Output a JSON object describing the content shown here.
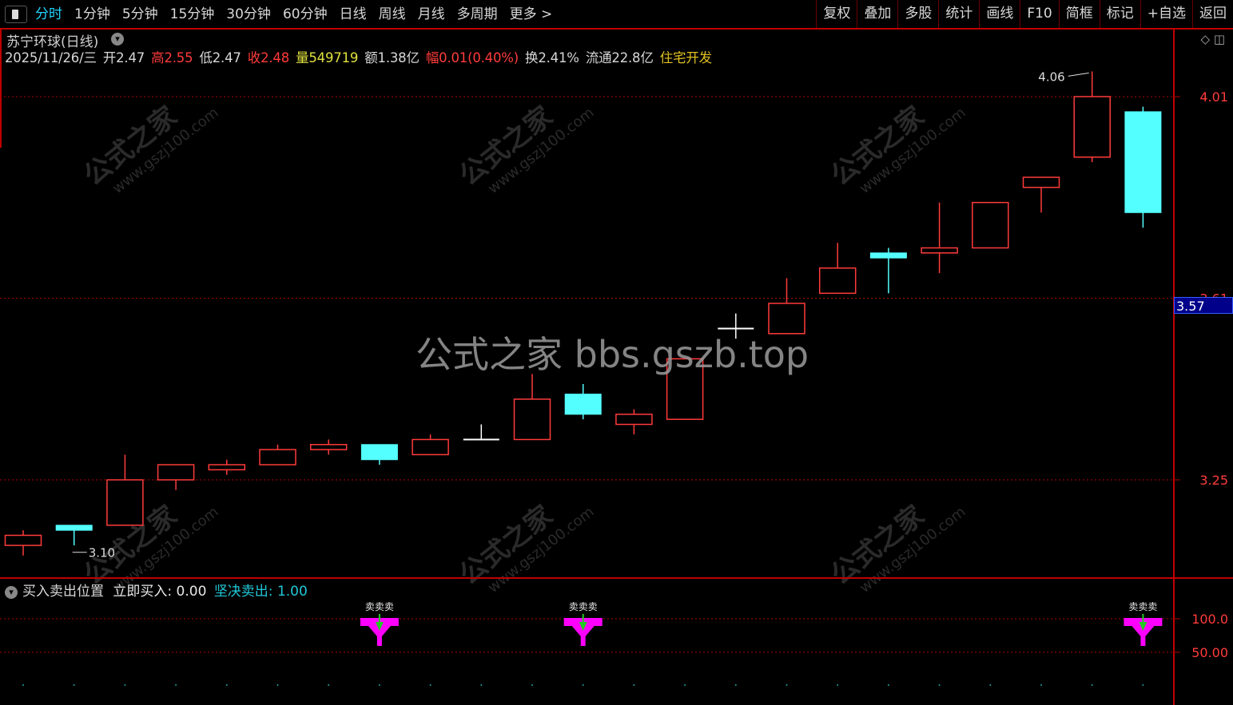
{
  "toolbar": {
    "toggle_icon": "panel-toggle-icon",
    "periods": [
      "分时",
      "1分钟",
      "5分钟",
      "15分钟",
      "30分钟",
      "60分钟",
      "日线",
      "周线",
      "月线",
      "多周期",
      "更多 >"
    ],
    "active_period": "分时",
    "right_tools": [
      "复权",
      "叠加",
      "多股",
      "统计",
      "画线",
      "F10",
      "简框",
      "标记",
      "+自选",
      "返回"
    ]
  },
  "stock": {
    "title": "苏宁环球(日线)",
    "date": "2025/11/26/三",
    "open_label": "开",
    "open": "2.47",
    "high_label": "高",
    "high": "2.55",
    "low_label": "低",
    "low": "2.47",
    "close_label": "收",
    "close": "2.48",
    "volume_label": "量",
    "volume": "549719",
    "amount_label": "额",
    "amount": "1.38亿",
    "change_label": "幅",
    "change": "0.01(0.40%)",
    "turnover_label": "换",
    "turnover": "2.41%",
    "float_label": "流通",
    "float": "22.8亿",
    "sector": "住宅开发"
  },
  "watermark": {
    "center": "公式之家 bbs.gszb.top",
    "tile_cn": "公式之家",
    "tile_url": "www.gszj100.com"
  },
  "price_tag": "3.57",
  "indicator": {
    "name": "买入卖出位置",
    "buy_label": "立即买入:",
    "buy_value": "0.00",
    "sell_label": "坚决卖出:",
    "sell_value": "1.00",
    "axis_labels": [
      "100.0",
      "50.00"
    ],
    "signal_text": "卖卖卖"
  },
  "colors": {
    "up": "#ff3b3b",
    "down": "#54ffff",
    "flat": "#ffffff",
    "grid": "#b00000",
    "axis_text": "#ff3b3b",
    "signal": "#ff00ff",
    "signal_arrow": "#22cc22",
    "accent": "#22d3ff"
  },
  "chart_data": {
    "type": "candlestick",
    "y_axis_ticks": [
      "4.01",
      "3.61",
      "3.25"
    ],
    "ylim": [
      3.06,
      4.1
    ],
    "annotations": {
      "high_label": "4.06",
      "low_label": "3.10"
    },
    "candles": [
      {
        "o": 3.12,
        "h": 3.15,
        "l": 3.1,
        "c": 3.14
      },
      {
        "o": 3.16,
        "h": 3.16,
        "l": 3.12,
        "c": 3.15
      },
      {
        "o": 3.16,
        "h": 3.3,
        "l": 3.16,
        "c": 3.25
      },
      {
        "o": 3.25,
        "h": 3.28,
        "l": 3.23,
        "c": 3.28
      },
      {
        "o": 3.27,
        "h": 3.29,
        "l": 3.26,
        "c": 3.28
      },
      {
        "o": 3.28,
        "h": 3.32,
        "l": 3.28,
        "c": 3.31
      },
      {
        "o": 3.31,
        "h": 3.33,
        "l": 3.3,
        "c": 3.32
      },
      {
        "o": 3.32,
        "h": 3.32,
        "l": 3.28,
        "c": 3.29
      },
      {
        "o": 3.3,
        "h": 3.34,
        "l": 3.3,
        "c": 3.33
      },
      {
        "o": 3.33,
        "h": 3.36,
        "l": 3.33,
        "c": 3.33
      },
      {
        "o": 3.33,
        "h": 3.46,
        "l": 3.33,
        "c": 3.41
      },
      {
        "o": 3.42,
        "h": 3.44,
        "l": 3.37,
        "c": 3.38
      },
      {
        "o": 3.36,
        "h": 3.39,
        "l": 3.34,
        "c": 3.38
      },
      {
        "o": 3.37,
        "h": 3.49,
        "l": 3.37,
        "c": 3.49
      },
      {
        "o": 3.55,
        "h": 3.58,
        "l": 3.53,
        "c": 3.55
      },
      {
        "o": 3.54,
        "h": 3.65,
        "l": 3.54,
        "c": 3.6
      },
      {
        "o": 3.62,
        "h": 3.72,
        "l": 3.62,
        "c": 3.67
      },
      {
        "o": 3.7,
        "h": 3.71,
        "l": 3.62,
        "c": 3.69
      },
      {
        "o": 3.7,
        "h": 3.8,
        "l": 3.66,
        "c": 3.71
      },
      {
        "o": 3.71,
        "h": 3.78,
        "l": 3.71,
        "c": 3.8
      },
      {
        "o": 3.83,
        "h": 3.85,
        "l": 3.78,
        "c": 3.85
      },
      {
        "o": 3.89,
        "h": 4.06,
        "l": 3.88,
        "c": 4.01
      },
      {
        "o": 3.98,
        "h": 3.99,
        "l": 3.75,
        "c": 3.78
      }
    ],
    "sell_signals": [
      7,
      11,
      22
    ],
    "signal_values": [
      100.0,
      100.0,
      100.0
    ]
  }
}
